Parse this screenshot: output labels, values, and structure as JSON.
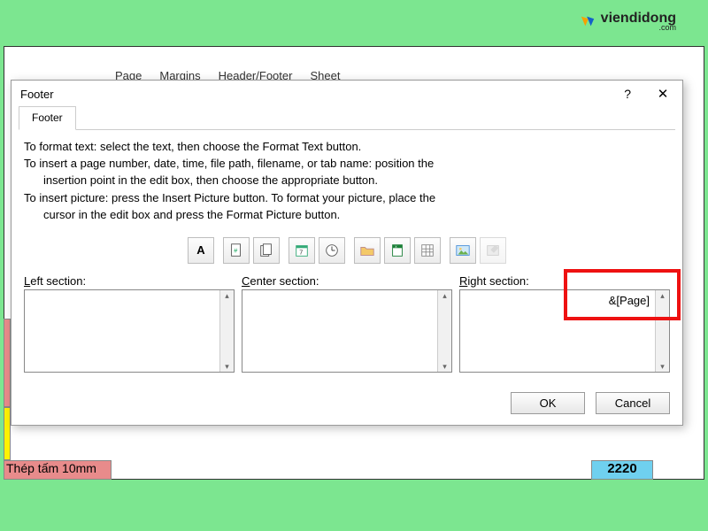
{
  "watermark": {
    "brand": "viendidong",
    "sub": ".com"
  },
  "bg": {
    "tabs": [
      "Page",
      "Margins",
      "Header/Footer",
      "Sheet"
    ],
    "redrow": "Thép tấm 10mm",
    "bluecell": "2220"
  },
  "dialog": {
    "title": "Footer",
    "tab_label": "Footer",
    "help": "?",
    "close": "✕",
    "instructions": {
      "l1": "To format text:  select the text, then choose the Format Text button.",
      "l2": "To insert a page number, date, time, file path, filename, or tab name:  position the",
      "l2b": "insertion point in the edit box, then choose the appropriate button.",
      "l3": "To insert picture: press the Insert Picture button.  To format your picture, place the",
      "l3b": "cursor in the edit box and press the Format Picture button."
    },
    "toolbar": {
      "format_text": "A",
      "icons": [
        "page-number-icon",
        "pages-icon",
        "date-icon",
        "time-icon",
        "file-path-icon",
        "file-name-icon",
        "sheet-name-icon",
        "insert-picture-icon",
        "format-picture-icon"
      ]
    },
    "sections": {
      "left_label_u": "L",
      "left_label": "eft section:",
      "center_label_u": "C",
      "center_label": "enter section:",
      "right_label_u": "R",
      "right_label": "ight section:",
      "right_value": "&[Page]"
    },
    "buttons": {
      "ok": "OK",
      "cancel": "Cancel"
    }
  }
}
